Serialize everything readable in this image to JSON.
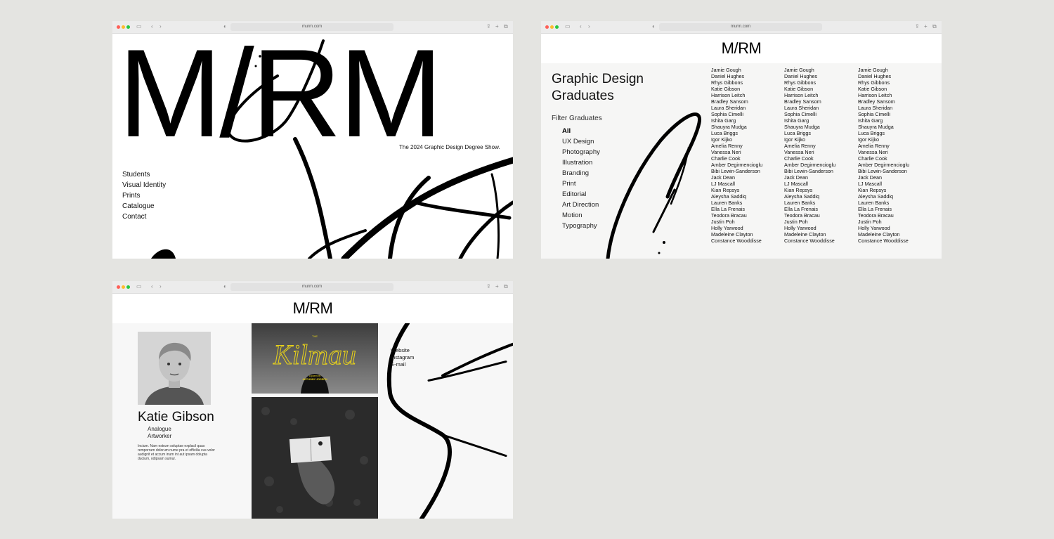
{
  "browser": {
    "url": "murm.com"
  },
  "home": {
    "logo": "M/RM",
    "tagline": "The 2024 Graphic Design Degree Show.",
    "nav": [
      "Students",
      "Visual Identity",
      "Prints",
      "Catalogue",
      "Contact"
    ]
  },
  "graduates": {
    "logo": "M/RM",
    "heading_line1": "Graphic Design",
    "heading_line2": "Graduates",
    "filter_label": "Filter Graduates",
    "categories": [
      "All",
      "UX Design",
      "Photography",
      "Illustration",
      "Branding",
      "Print",
      "Editorial",
      "Art Direction",
      "Motion",
      "Typography"
    ],
    "active_category": "All",
    "names": [
      "Jamie Gough",
      "Daniel Hughes",
      "Rhys Gibbons",
      "Katie Gibson",
      "Harrison Leitch",
      "Bradley Sansom",
      "Laura Sheridan",
      "Sophia Cimelli",
      "Ishita Garg",
      "Shauyra Mudga",
      "Luca Briggs",
      "Igor Kijko",
      "Amelia Renny",
      "Vanessa Neri",
      "Charlie Cook",
      "Amber Degirmencioglu",
      "Bibi Lewin-Sanderson",
      "Jack Dean",
      "LJ Mascall",
      "Kian Repsys",
      "Aleysha Saddiq",
      "Lauren Banks",
      "Ella La Frenais",
      "Teodora Bracau",
      "Justin Poh",
      "Holly Yarwood",
      "Madeleine Clayton",
      "Constance Wooddisse"
    ]
  },
  "profile": {
    "logo": "M/RM",
    "name": "Katie Gibson",
    "roles": [
      "Analogue",
      "Artworker"
    ],
    "bio": "Incium. Nam estrum soluptae explacil quas remporrum dolorum nume pra et officilia cus volor audignit et accum inum int aut ipsam dolupta ducium, odipsam sumur.",
    "poster_small": "THE",
    "poster_title": "Kilmau",
    "poster_sub1": "a poem by",
    "poster_sub2": "ANTHONY JOSEPH",
    "links": [
      "Website",
      "Instagram",
      "E-mail"
    ],
    "accent": "#e8d21a"
  }
}
